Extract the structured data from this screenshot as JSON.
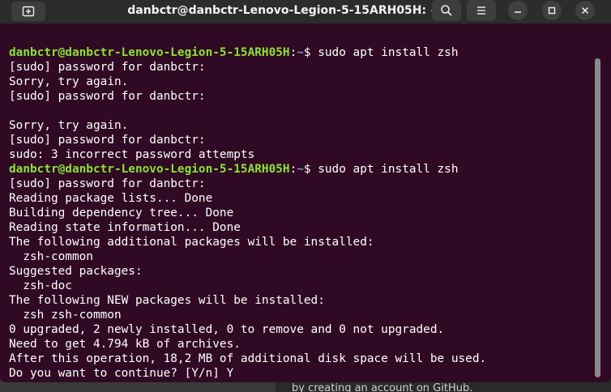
{
  "window": {
    "title": "danbctr@danbctr-Lenovo-Legion-5-15ARH05H: ~"
  },
  "background": {
    "snippet": "by creating an account on GitHub."
  },
  "icons": {
    "new_tab": "new-tab-icon",
    "search": "search-icon",
    "menu": "hamburger-menu-icon",
    "minimize": "minimize-icon",
    "maximize": "maximize-icon",
    "close": "close-icon"
  },
  "colors": {
    "terminal_bg": "#300a24",
    "prompt_user": "#8ae234",
    "prompt_path": "#729fcf",
    "text": "#ffffff"
  },
  "terminal": {
    "prompt": {
      "user_host": "danbctr@danbctr-Lenovo-Legion-5-15ARH05H",
      "separator": ":",
      "path": "~",
      "symbol": "$ "
    },
    "lines": [
      {
        "type": "prompt",
        "command": "sudo apt install zsh"
      },
      {
        "type": "output",
        "text": "[sudo] password for danbctr:"
      },
      {
        "type": "output",
        "text": "Sorry, try again."
      },
      {
        "type": "output",
        "text": "[sudo] password for danbctr:"
      },
      {
        "type": "output",
        "text": ""
      },
      {
        "type": "output",
        "text": "Sorry, try again."
      },
      {
        "type": "output",
        "text": "[sudo] password for danbctr:"
      },
      {
        "type": "output",
        "text": "sudo: 3 incorrect password attempts"
      },
      {
        "type": "prompt",
        "command": "sudo apt install zsh"
      },
      {
        "type": "output",
        "text": "[sudo] password for danbctr:"
      },
      {
        "type": "output",
        "text": "Reading package lists... Done"
      },
      {
        "type": "output",
        "text": "Building dependency tree... Done"
      },
      {
        "type": "output",
        "text": "Reading state information... Done"
      },
      {
        "type": "output",
        "text": "The following additional packages will be installed:"
      },
      {
        "type": "output",
        "text": "  zsh-common"
      },
      {
        "type": "output",
        "text": "Suggested packages:"
      },
      {
        "type": "output",
        "text": "  zsh-doc"
      },
      {
        "type": "output",
        "text": "The following NEW packages will be installed:"
      },
      {
        "type": "output",
        "text": "  zsh zsh-common"
      },
      {
        "type": "output",
        "text": "0 upgraded, 2 newly installed, 0 to remove and 0 not upgraded."
      },
      {
        "type": "output",
        "text": "Need to get 4.794 kB of archives."
      },
      {
        "type": "output",
        "text": "After this operation, 18,2 MB of additional disk space will be used."
      },
      {
        "type": "output",
        "text": "Do you want to continue? [Y/n] Y"
      }
    ]
  }
}
